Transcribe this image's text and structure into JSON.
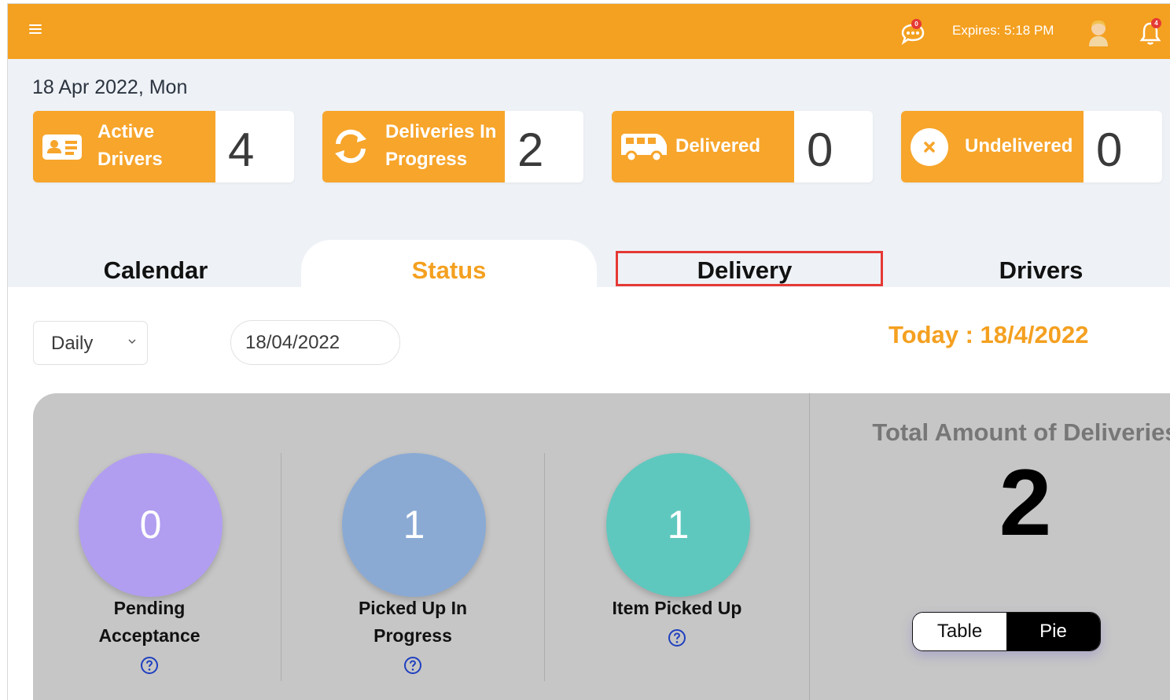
{
  "header": {
    "expires": "Expires: 5:18 PM",
    "chat_badge": "0",
    "bell_badge": "4"
  },
  "date": "18 Apr 2022, Mon",
  "stats": [
    {
      "label_line1": "Active",
      "label_line2": "Drivers",
      "value": "4",
      "icon": "id-card-icon"
    },
    {
      "label_line1": "Deliveries In",
      "label_line2": "Progress",
      "value": "2",
      "icon": "refresh-icon"
    },
    {
      "label_line1": "Delivered",
      "label_line2": "",
      "value": "0",
      "icon": "van-icon"
    },
    {
      "label_line1": "Undelivered",
      "label_line2": "",
      "value": "0",
      "icon": "x-circle-icon"
    }
  ],
  "tabs": [
    "Calendar",
    "Status",
    "Delivery",
    "Drivers"
  ],
  "active_tab": "Status",
  "filters": {
    "period": "Daily",
    "date": "18/04/2022",
    "today": "Today : 18/4/2022"
  },
  "status_cards": [
    {
      "value": "0",
      "label_line1": "Pending",
      "label_line2": "Acceptance",
      "color": "#b19ef0"
    },
    {
      "value": "1",
      "label_line1": "Picked Up In",
      "label_line2": "Progress",
      "color": "#8aaad4"
    },
    {
      "value": "1",
      "label_line1": "Item Picked Up",
      "label_line2": "",
      "color": "#5fc8be"
    }
  ],
  "total": {
    "title": "Total Amount of Deliveries",
    "value": "2"
  },
  "view_toggle": {
    "table": "Table",
    "pie": "Pie",
    "selected": "Pie"
  },
  "colors": {
    "brand_orange": "#f4a020",
    "card_orange": "#f7a52b",
    "panel_gray": "#c6c6c6"
  }
}
